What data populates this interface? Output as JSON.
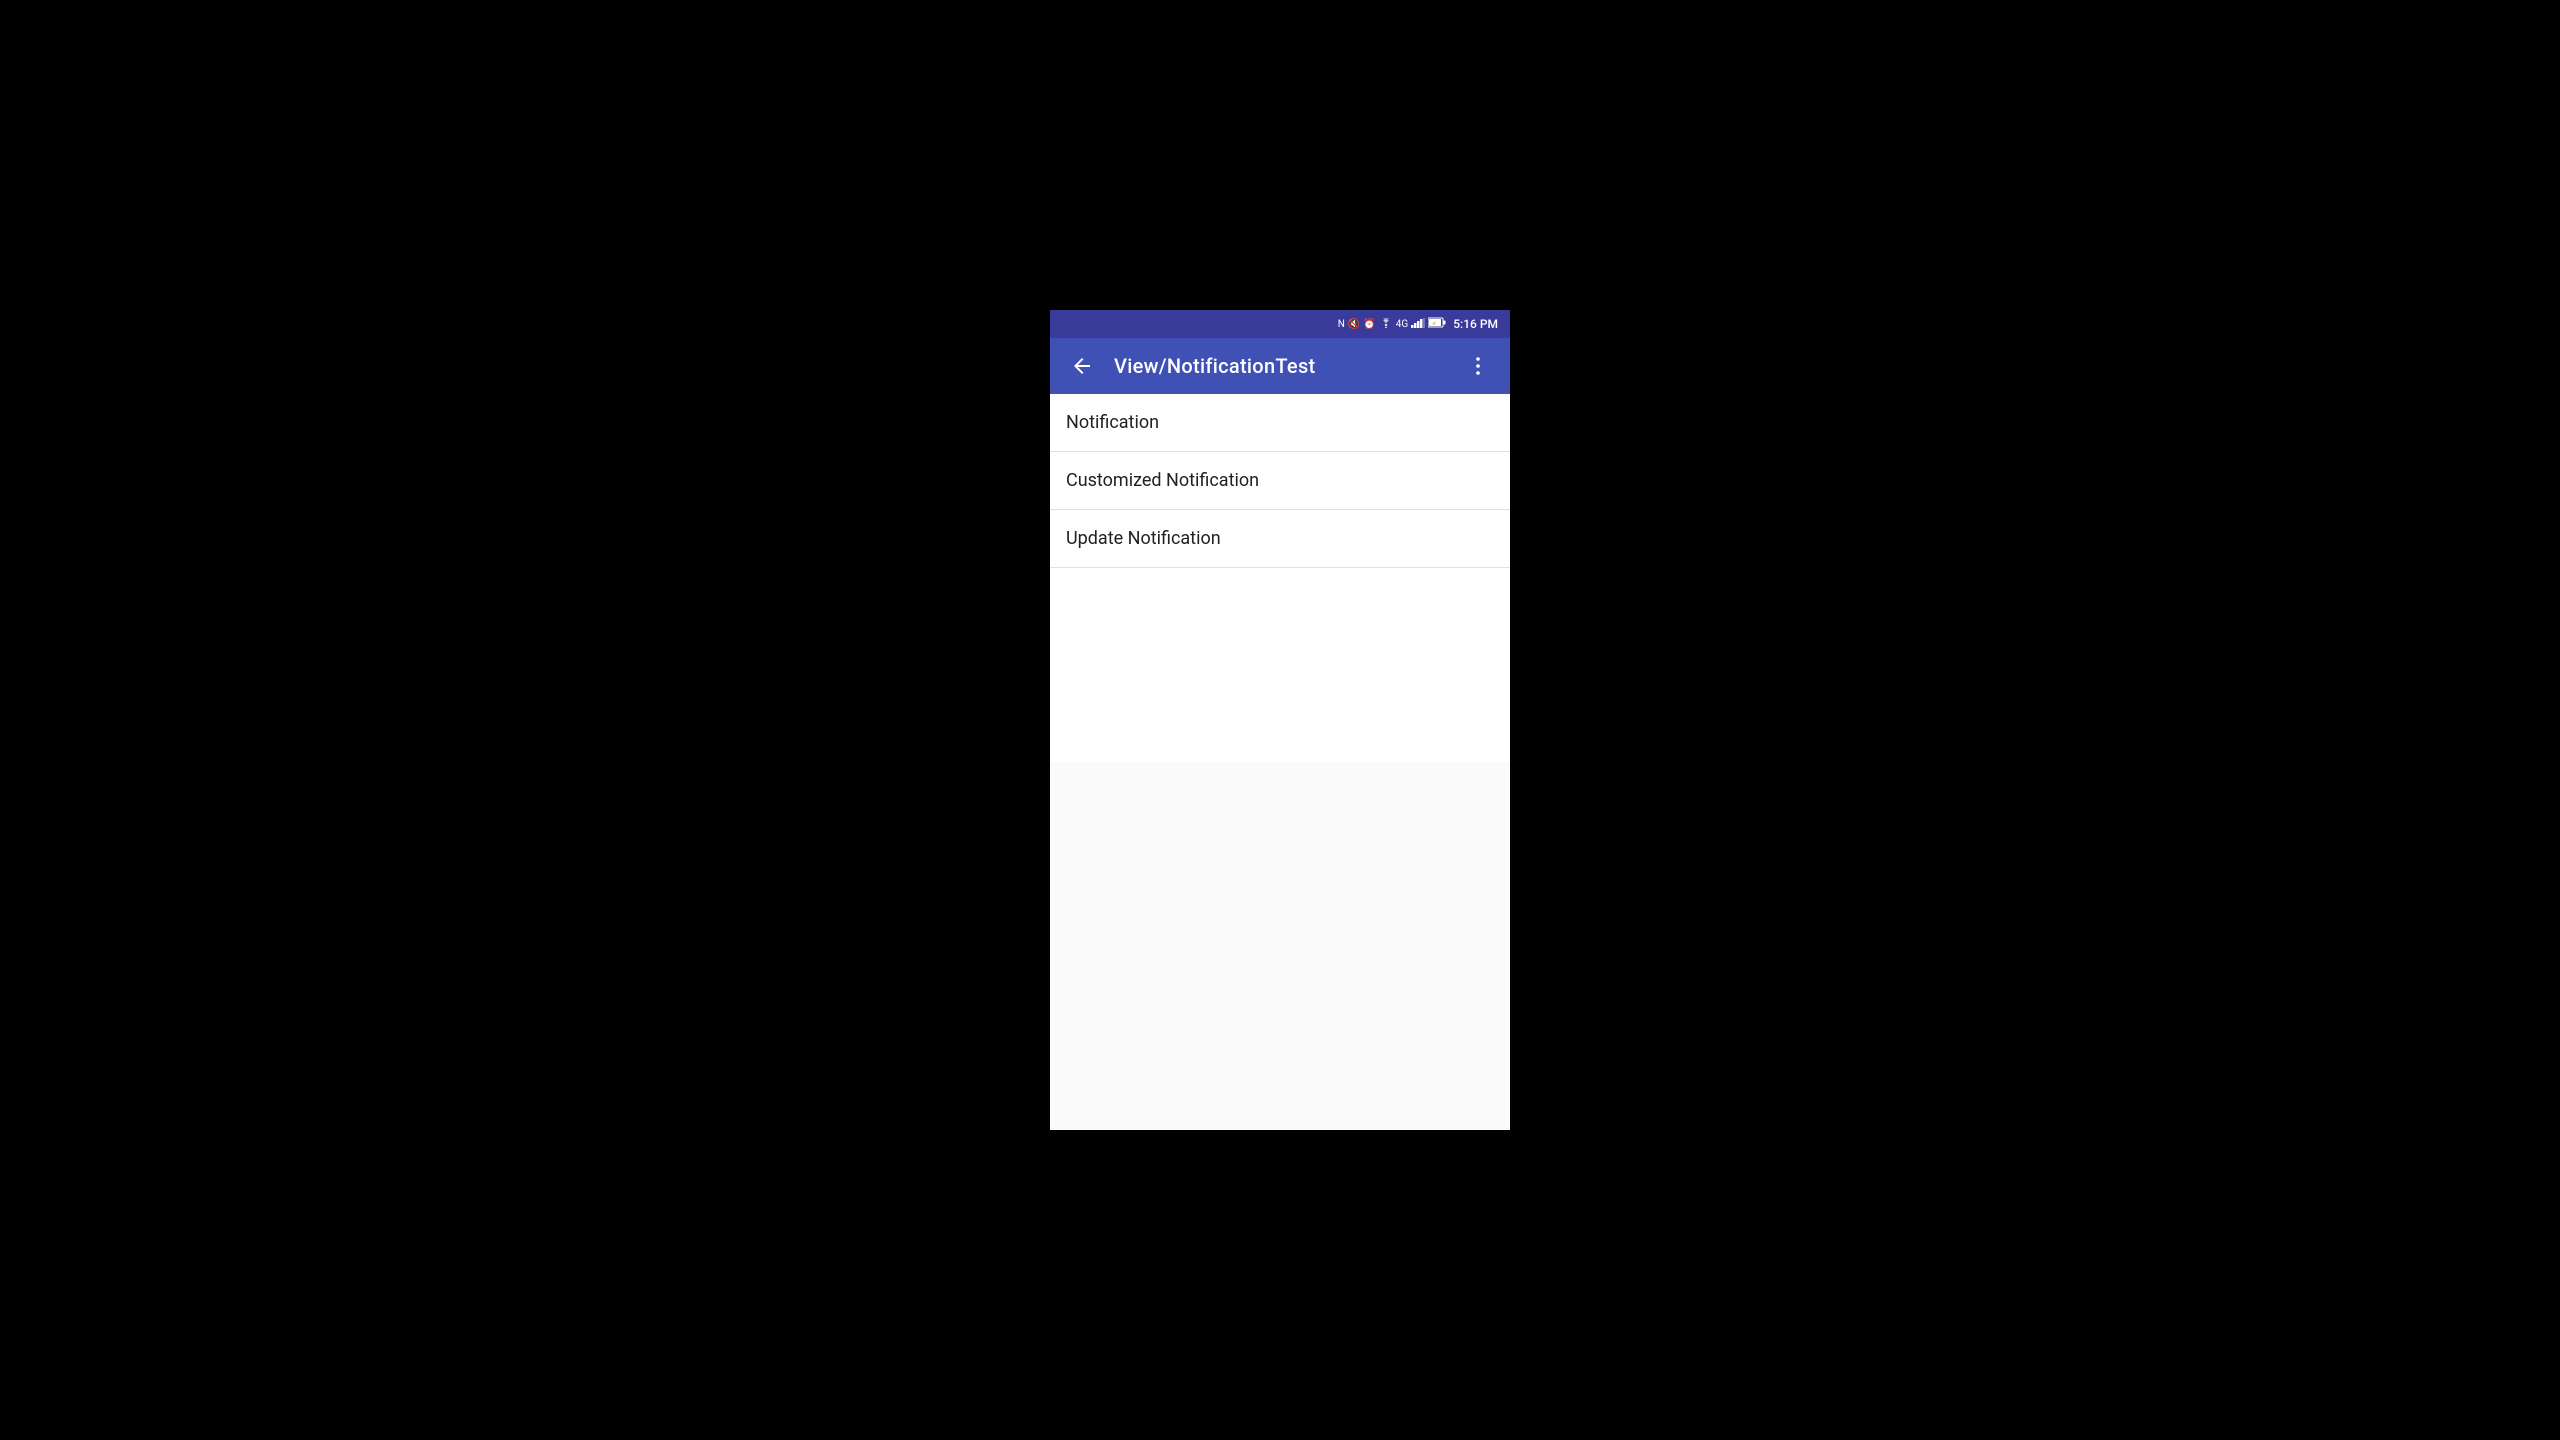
{
  "statusBar": {
    "time": "5:16 PM",
    "icons": {
      "signal1": "N",
      "mute": "🔇",
      "alarm": "⏰",
      "wifi": "WiFi",
      "networkType": "4G",
      "signal2": "▋▋▋",
      "battery": "🔋"
    }
  },
  "appBar": {
    "title": "View/NotificationTest",
    "backArrow": "←",
    "menuIcon": "⋮"
  },
  "listItems": [
    {
      "id": "notification",
      "label": "Notification"
    },
    {
      "id": "customized-notification",
      "label": "Customized Notification"
    },
    {
      "id": "update-notification",
      "label": "Update Notification"
    }
  ],
  "colors": {
    "appBarBg": "#3f51b5",
    "statusBarBg": "#3a3a9a",
    "listBg": "#ffffff",
    "divider": "#e0e0e0",
    "textPrimary": "#212121",
    "textWhite": "#ffffff"
  }
}
